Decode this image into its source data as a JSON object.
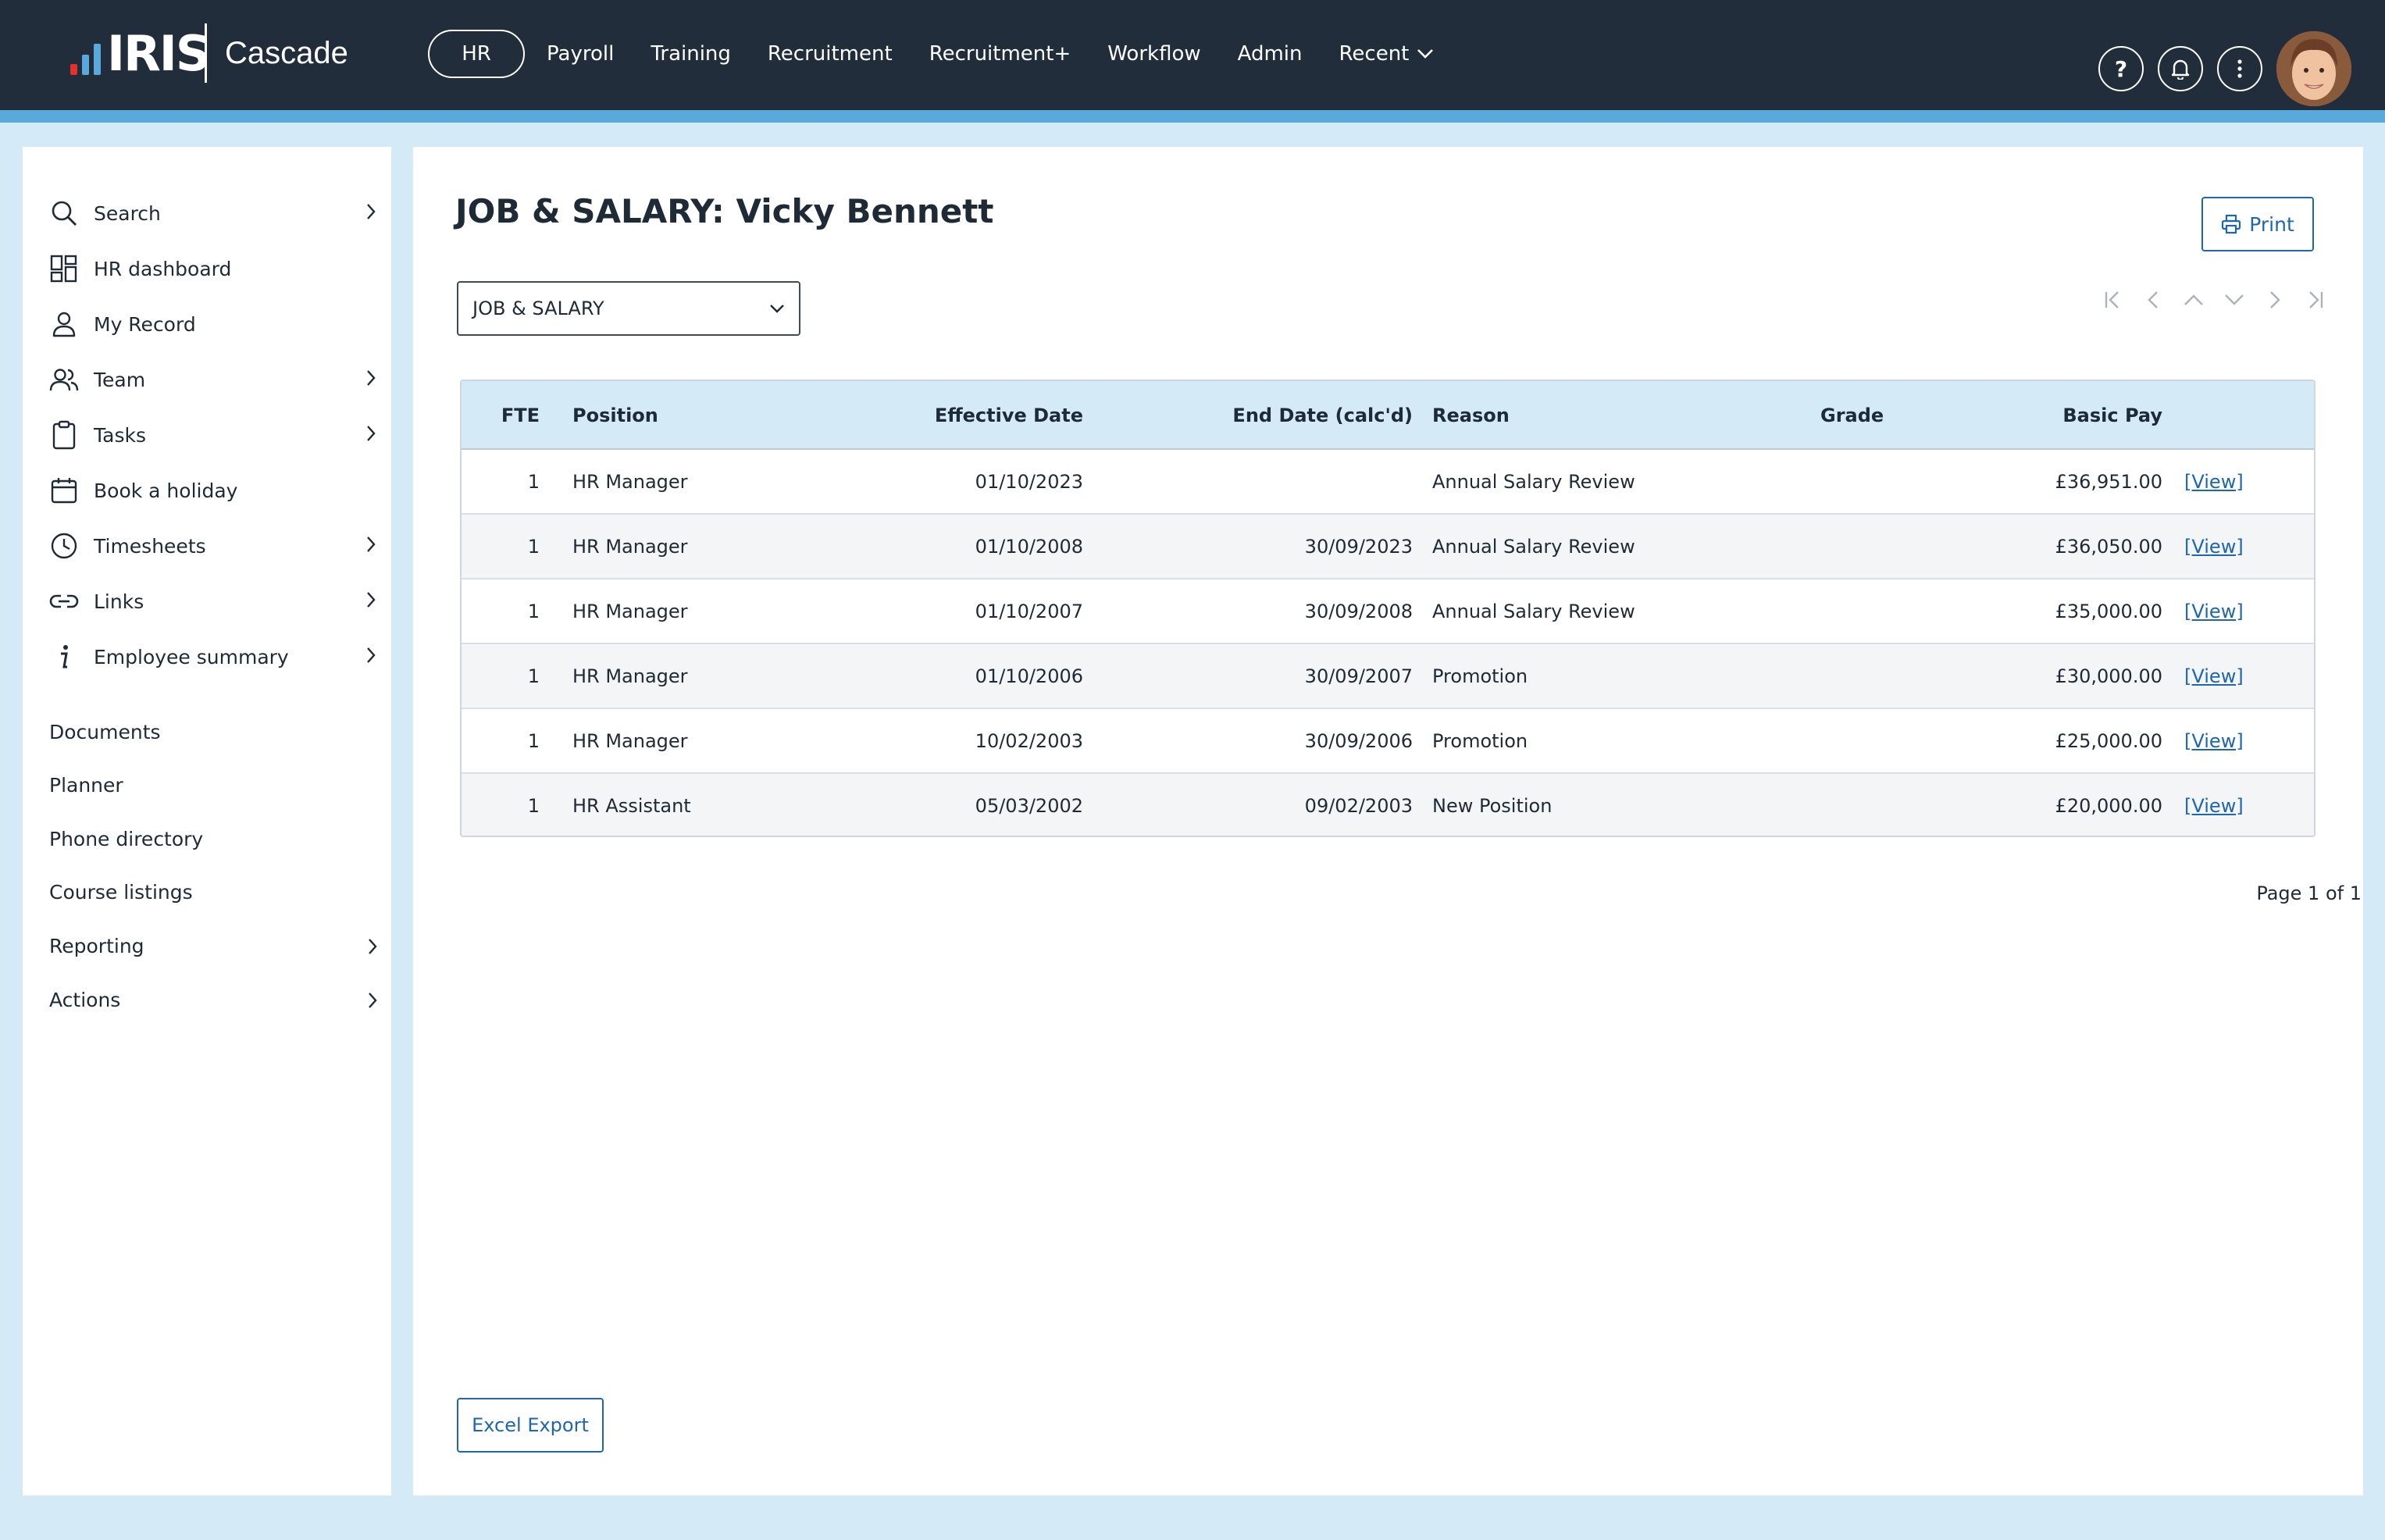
{
  "brand": {
    "logo_text": "IRIS",
    "app_name": "Cascade",
    "bar_colors": [
      "#e4322b",
      "#f39200",
      "#5aa9dc"
    ]
  },
  "nav": {
    "items": [
      "HR",
      "Payroll",
      "Training",
      "Recruitment",
      "Recruitment+",
      "Workflow",
      "Admin"
    ],
    "recent_label": "Recent",
    "active": "HR"
  },
  "top_icons": {
    "help": "?",
    "help_icon": "help-icon",
    "notifications_icon": "bell-icon",
    "more_icon": "more-vertical-icon",
    "avatar_icon": "user-avatar"
  },
  "sidebar": {
    "items": [
      {
        "label": "Search",
        "icon": "search-icon",
        "has_chevron": true
      },
      {
        "label": "HR dashboard",
        "icon": "dashboard-icon",
        "has_chevron": false
      },
      {
        "label": "My Record",
        "icon": "person-icon",
        "has_chevron": false
      },
      {
        "label": "Team",
        "icon": "team-icon",
        "has_chevron": true
      },
      {
        "label": "Tasks",
        "icon": "clipboard-icon",
        "has_chevron": true
      },
      {
        "label": "Book a holiday",
        "icon": "calendar-icon",
        "has_chevron": false
      },
      {
        "label": "Timesheets",
        "icon": "clock-icon",
        "has_chevron": true
      },
      {
        "label": "Links",
        "icon": "link-icon",
        "has_chevron": true
      },
      {
        "label": "Employee summary",
        "icon": "info-icon",
        "has_chevron": true
      }
    ],
    "plain_items": [
      {
        "label": "Documents",
        "has_chevron": false
      },
      {
        "label": "Planner",
        "has_chevron": false
      },
      {
        "label": "Phone directory",
        "has_chevron": false
      },
      {
        "label": "Course listings",
        "has_chevron": false
      },
      {
        "label": "Reporting",
        "has_chevron": true
      },
      {
        "label": "Actions",
        "has_chevron": true
      }
    ]
  },
  "main": {
    "title": "JOB & SALARY:  Vicky Bennett",
    "print_label": "Print",
    "view_select": {
      "value": "JOB & SALARY"
    },
    "pager_icons": [
      "first-page-icon",
      "previous-page-icon",
      "previous-record-icon",
      "next-record-icon",
      "next-page-icon",
      "last-page-icon"
    ],
    "table": {
      "headers": {
        "fte": "FTE",
        "position": "Position",
        "effective_date": "Effective Date",
        "end_date": "End Date (calc'd)",
        "reason": "Reason",
        "grade": "Grade",
        "basic_pay": "Basic Pay"
      },
      "rows": [
        {
          "fte": "1",
          "position": "HR Manager",
          "effective_date": "01/10/2023",
          "end_date": "",
          "reason": "Annual Salary Review",
          "grade": "",
          "basic_pay": "£36,951.00",
          "view": "[View]"
        },
        {
          "fte": "1",
          "position": "HR Manager",
          "effective_date": "01/10/2008",
          "end_date": "30/09/2023",
          "reason": "Annual Salary Review",
          "grade": "",
          "basic_pay": "£36,050.00",
          "view": "[View]"
        },
        {
          "fte": "1",
          "position": "HR Manager",
          "effective_date": "01/10/2007",
          "end_date": "30/09/2008",
          "reason": "Annual Salary Review",
          "grade": "",
          "basic_pay": "£35,000.00",
          "view": "[View]"
        },
        {
          "fte": "1",
          "position": "HR Manager",
          "effective_date": "01/10/2006",
          "end_date": "30/09/2007",
          "reason": "Promotion",
          "grade": "",
          "basic_pay": "£30,000.00",
          "view": "[View]"
        },
        {
          "fte": "1",
          "position": "HR Manager",
          "effective_date": "10/02/2003",
          "end_date": "30/09/2006",
          "reason": "Promotion",
          "grade": "",
          "basic_pay": "£25,000.00",
          "view": "[View]"
        },
        {
          "fte": "1",
          "position": "HR Assistant",
          "effective_date": "05/03/2002",
          "end_date": "09/02/2003",
          "reason": "New Position",
          "grade": "",
          "basic_pay": "£20,000.00",
          "view": "[View]"
        }
      ]
    },
    "page_info": "Page 1 of 1",
    "excel_export_label": "Excel Export"
  }
}
